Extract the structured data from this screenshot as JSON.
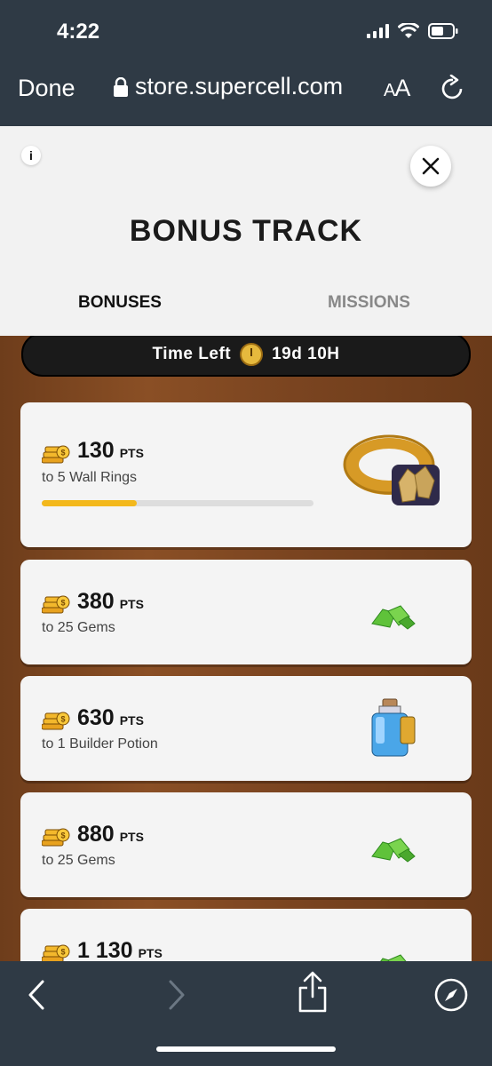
{
  "status_bar": {
    "time": "4:22"
  },
  "browser": {
    "done_label": "Done",
    "url": "store.supercell.com",
    "text_size_big": "A",
    "text_size_small": "A"
  },
  "modal": {
    "info_label": "i",
    "title": "BONUS TRACK",
    "tabs": [
      {
        "label": "BONUSES",
        "active": true
      },
      {
        "label": "MISSIONS",
        "active": false
      }
    ]
  },
  "timer": {
    "label": "Time Left",
    "value": "19d 10H"
  },
  "bonuses": [
    {
      "points": "130",
      "unit": "PTS",
      "reward": "to 5 Wall Rings",
      "icon": "wall-ring-icon",
      "progress": 0.35
    },
    {
      "points": "380",
      "unit": "PTS",
      "reward": "to 25 Gems",
      "icon": "gems-icon"
    },
    {
      "points": "630",
      "unit": "PTS",
      "reward": "to 1 Builder Potion",
      "icon": "builder-potion-icon"
    },
    {
      "points": "880",
      "unit": "PTS",
      "reward": "to 25 Gems",
      "icon": "gems-icon"
    },
    {
      "points": "1 130",
      "unit": "PTS",
      "icon": "gems-icon"
    }
  ],
  "colors": {
    "chrome": "#2f3a45",
    "progress": "#f3b81c",
    "gem": "#5fc23a"
  }
}
